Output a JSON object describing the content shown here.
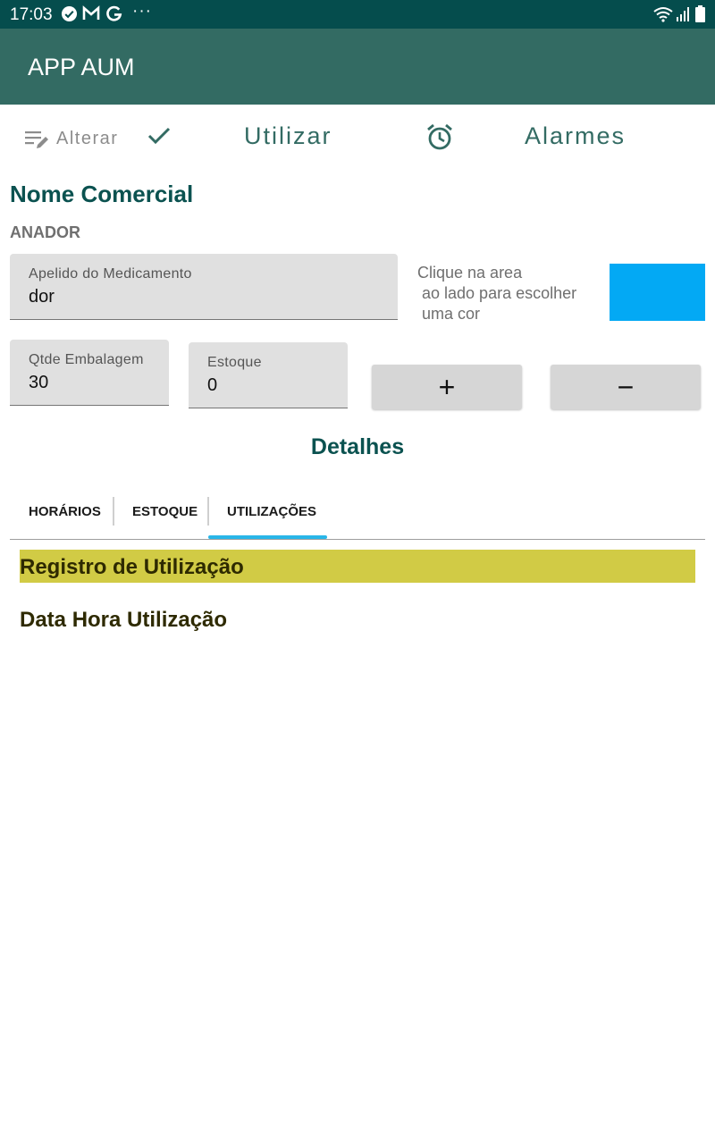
{
  "status_bar": {
    "time": "17:03",
    "icons": [
      "check-circle-icon",
      "gmail-icon",
      "google-icon",
      "more-notifications-icon",
      "wifi-icon",
      "signal-icon",
      "battery-icon"
    ],
    "more": "···"
  },
  "app_bar": {
    "title": "APP AUM"
  },
  "toolbar": {
    "edit_label": "Alterar",
    "use_label": "Utilizar",
    "alarms_label": "Alarmes"
  },
  "medicine": {
    "section_title": "Nome Comercial",
    "name": "ANADOR",
    "nickname_label": "Apelido do Medicamento",
    "nickname_value": "dor",
    "color_hint_line1": "Clique na area",
    "color_hint_line2": "ao lado para escolher",
    "color_hint_line3": "uma cor",
    "selected_color": "#03a9f4",
    "package_qty_label": "Qtde Embalagem",
    "package_qty_value": "30",
    "stock_label": "Estoque",
    "stock_value": "0",
    "plus_label": "+",
    "minus_label": "−"
  },
  "details": {
    "title": "Detalhes",
    "tabs": [
      {
        "label": "HORÁRIOS"
      },
      {
        "label": "ESTOQUE"
      },
      {
        "label": "UTILIZAÇÕES",
        "active": true
      }
    ]
  },
  "usage": {
    "header": "Registro de Utilização",
    "column_label": "Data Hora Utilização"
  },
  "colors": {
    "status_bar": "#054d4d",
    "app_bar": "#336b63",
    "accent_text": "#336b63",
    "section_title": "#0b5250",
    "tab_indicator": "#29b6e8",
    "usage_header_bg": "#d1cb45",
    "usage_text": "#2e2a00"
  }
}
